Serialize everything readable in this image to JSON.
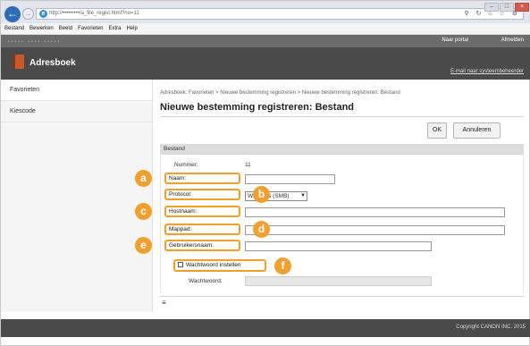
{
  "browser": {
    "url": "http://•••••••••/a_file_regist.html?no=11",
    "search_hint": "ρ • ĉ",
    "menu": [
      "Bestand",
      "Bewerken",
      "Beeld",
      "Favorieten",
      "Extra",
      "Help"
    ]
  },
  "app": {
    "portal_link": "Naar portal",
    "logout_link": "Afmelden",
    "title": "Adresboek",
    "admin_email_link": "E-mail naar systeembeheerder"
  },
  "sidebar": {
    "items": [
      {
        "label": "Favorieten"
      },
      {
        "label": "Kiescode"
      }
    ]
  },
  "main": {
    "breadcrumb": "Adresboek: Favorieten > Nieuwe bestemming registreren > Nieuwe bestemming registreren: Bestand",
    "title": "Nieuwe bestemming registreren: Bestand",
    "ok_label": "OK",
    "cancel_label": "Annuleren",
    "section_title": "Bestand"
  },
  "form": {
    "number_label": "Nummer:",
    "number_value": "11",
    "name_label": "Naam:",
    "protocol_label": "Protocol:",
    "protocol_value": "Windows (SMB)",
    "hostname_label": "Hostnaam:",
    "folder_label": "Mappad:",
    "username_label": "Gebruikersnaam:",
    "set_password_label": "Wachtwoord instellen",
    "password_label": "Wachtwoord:"
  },
  "callouts": {
    "a": "a",
    "b": "b",
    "c": "c",
    "d": "d",
    "e": "e",
    "f": "f"
  },
  "footer": {
    "collapse_symbol": "≡",
    "copyright": "Copyright CANON INC. 2015"
  },
  "colors": {
    "callout": "#f0a030",
    "header": "#4a4a4a",
    "book_icon": "#c8582a"
  }
}
